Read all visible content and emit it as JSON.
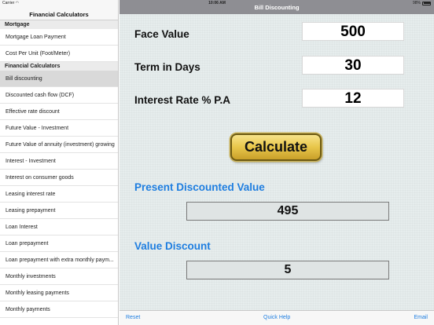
{
  "status": {
    "carrier": "Carrier",
    "time": "10:06 AM",
    "battery": "98%"
  },
  "sidebar": {
    "title": "Financial Calculators",
    "sections": [
      {
        "title": "Mortgage",
        "items": [
          "Mortgage Loan Payment",
          "Cost Per Unit (Foot/Meter)"
        ]
      },
      {
        "title": "Financial Calculators",
        "items": [
          "Bill discounting",
          "Discounted cash flow (DCF)",
          "Effective rate discount",
          "Future Value - Investment",
          "Future Value of annuity (investment) growing",
          "Interest - Investment",
          "Interest on consumer goods",
          "Leasing interest rate",
          "Leasing prepayment",
          "Loan Interest",
          "Loan prepayment",
          "Loan prepayment with extra monthly paym...",
          "Monthly investments",
          "Monthly leasing payments",
          "Monthly payments"
        ]
      }
    ],
    "selected": "Bill discounting"
  },
  "main": {
    "title": "Bill Discounting",
    "fields": [
      {
        "label": "Face Value",
        "value": "500"
      },
      {
        "label": "Term in Days",
        "value": "30"
      },
      {
        "label": "Interest Rate % P.A",
        "value": "12"
      }
    ],
    "calculate_label": "Calculate",
    "results": [
      {
        "label": "Present Discounted Value",
        "value": "495"
      },
      {
        "label": "Value Discount",
        "value": "5"
      }
    ]
  },
  "toolbar": {
    "reset": "Reset",
    "help": "Quick Help",
    "email": "Email"
  },
  "colors": {
    "accent": "#1f7ee0",
    "navbar": "#8e8e93",
    "button": "#e8c64a"
  }
}
